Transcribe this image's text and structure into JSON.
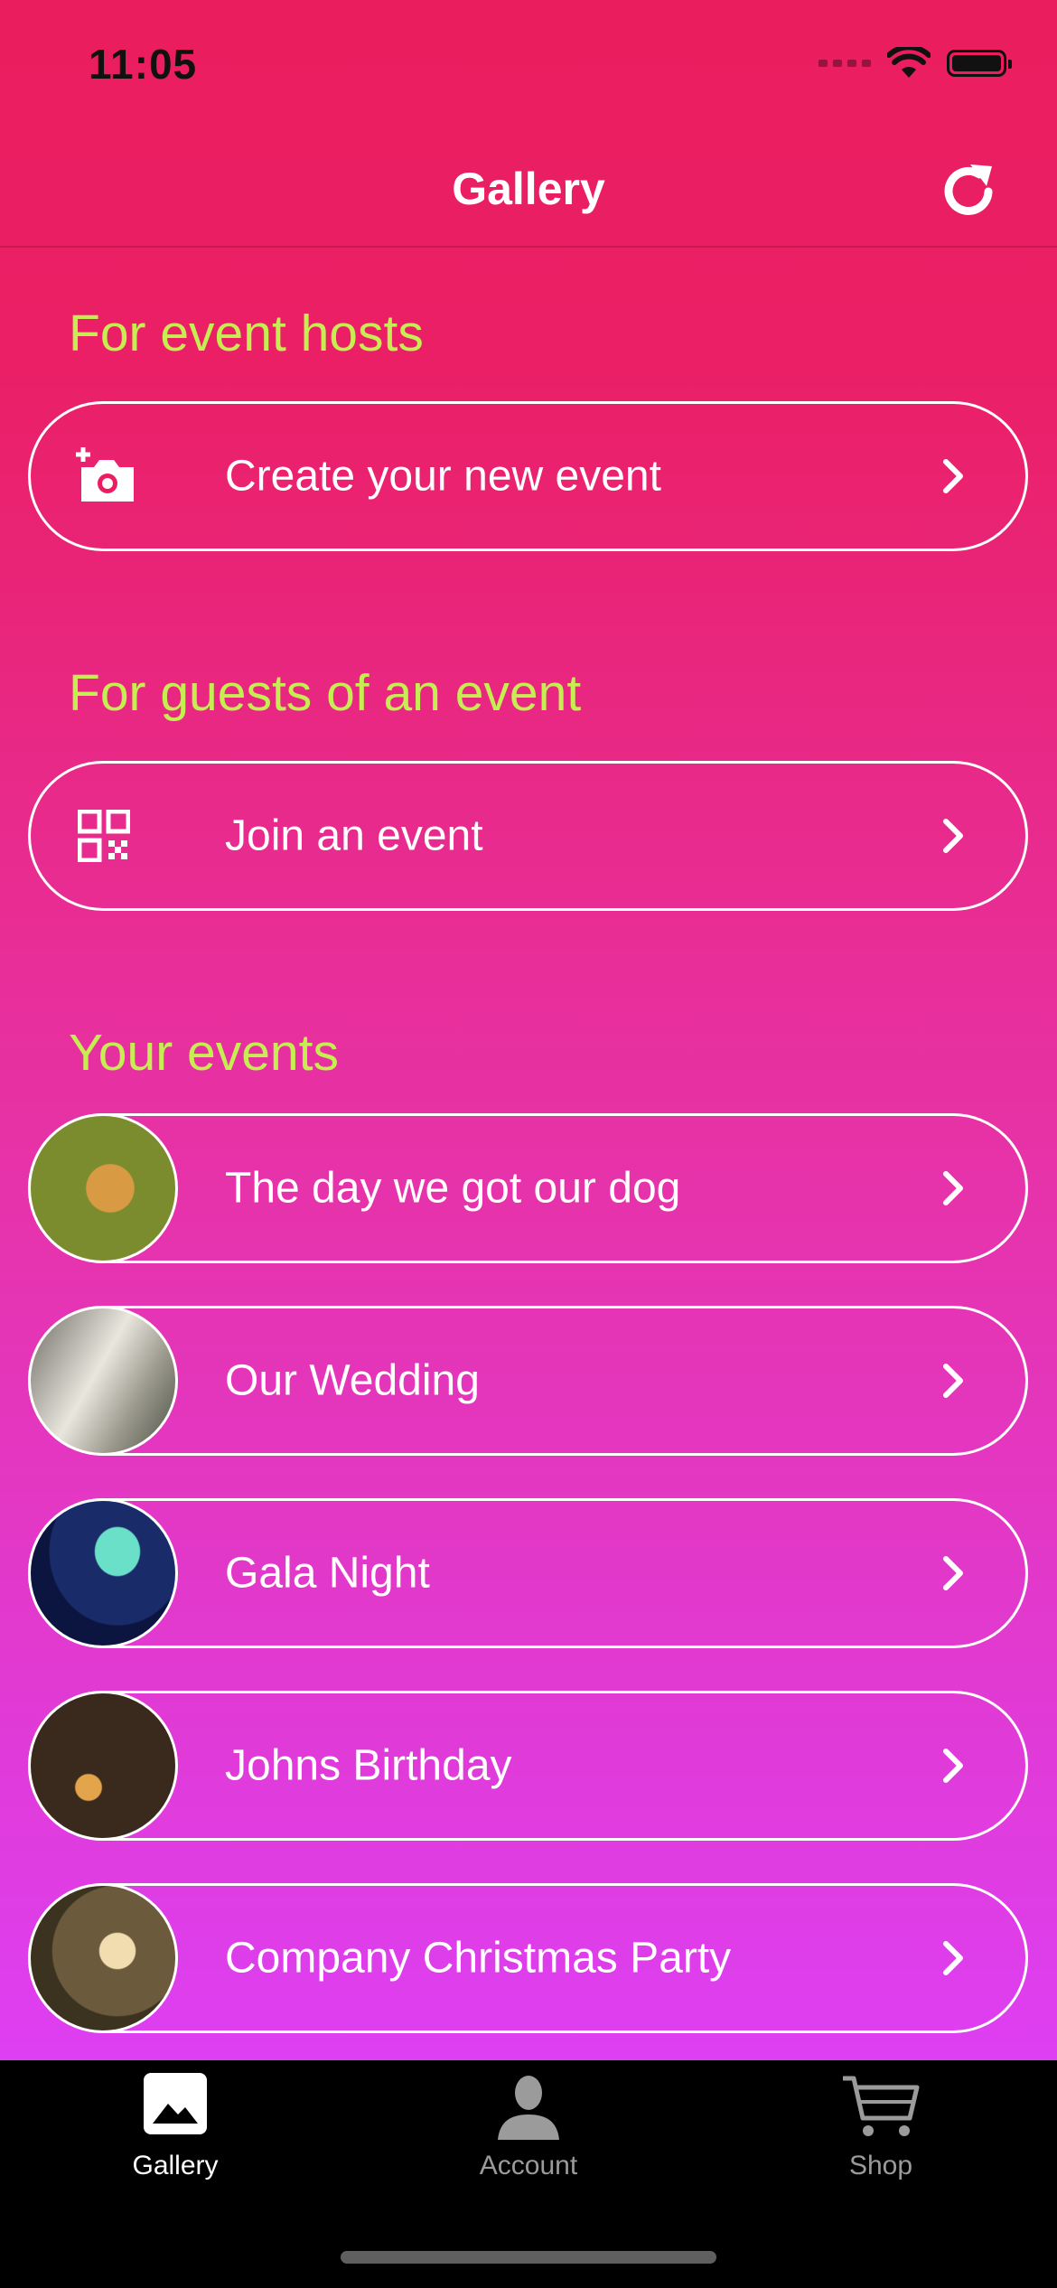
{
  "status_bar": {
    "time": "11:05"
  },
  "header": {
    "title": "Gallery"
  },
  "sections": {
    "hosts": {
      "title": "For event hosts",
      "action_label": "Create your new event"
    },
    "guests": {
      "title": "For guests of an event",
      "action_label": "Join an event"
    },
    "events": {
      "title": "Your events",
      "items": [
        {
          "label": "The day we got our dog"
        },
        {
          "label": "Our Wedding"
        },
        {
          "label": "Gala Night"
        },
        {
          "label": "Johns Birthday"
        },
        {
          "label": "Company Christmas Party"
        }
      ]
    }
  },
  "tabbar": {
    "tabs": [
      {
        "label": "Gallery",
        "icon": "photo-icon",
        "active": true
      },
      {
        "label": "Account",
        "icon": "person-icon",
        "active": false
      },
      {
        "label": "Shop",
        "icon": "cart-icon",
        "active": false
      }
    ]
  },
  "colors": {
    "gradient_top": "#ea1e5e",
    "gradient_bottom": "#dd3ff2",
    "section_title": "#c6ee52",
    "tab_active": "#ffffff",
    "tab_inactive": "#9b9b9b"
  }
}
